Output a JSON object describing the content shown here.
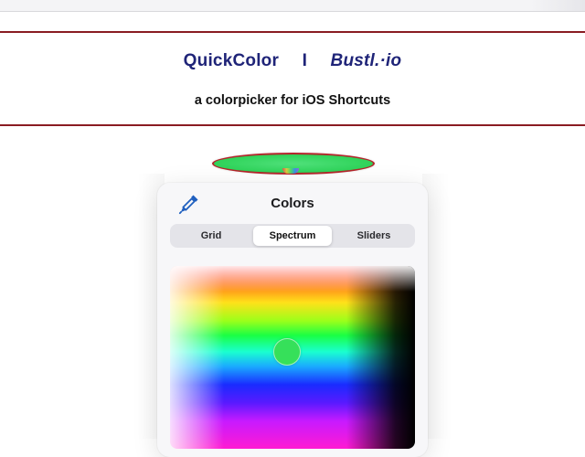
{
  "header": {
    "app_name": "QuickColor",
    "separator": "I",
    "brand": "Bustl.·io",
    "subtitle": "a colorpicker for iOS Shortcuts"
  },
  "selected_color": {
    "hex": "#33d55e",
    "border_color": "#b4242a"
  },
  "picker": {
    "title": "Colors",
    "eyedropper_icon": "eyedropper-icon",
    "tabs": [
      {
        "label": "Grid",
        "selected": false
      },
      {
        "label": "Spectrum",
        "selected": true
      },
      {
        "label": "Sliders",
        "selected": false
      }
    ]
  },
  "colors": {
    "brand_text": "#1f2478",
    "header_rule": "#8a1c22",
    "accent_blue": "#1f5fbf"
  }
}
